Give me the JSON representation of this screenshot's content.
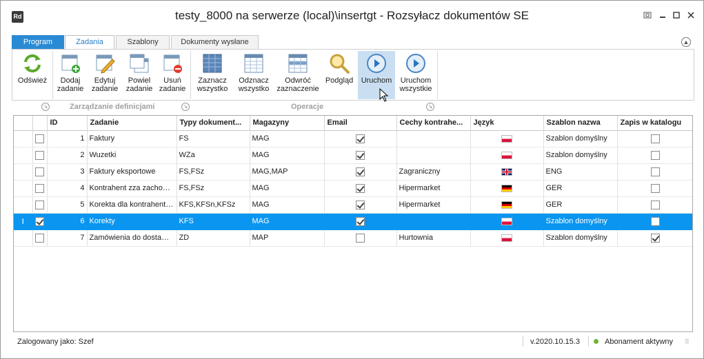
{
  "window": {
    "title": "testy_8000 na serwerze (local)\\insertgt - Rozsyłacz dokumentów SE",
    "logo_text": "Rd"
  },
  "tabs": [
    {
      "label": "Program"
    },
    {
      "label": "Zadania"
    },
    {
      "label": "Szablony"
    },
    {
      "label": "Dokumenty wysłane"
    }
  ],
  "ribbon": {
    "refresh": "Odśwież",
    "add": "Dodaj\nzadanie",
    "edit": "Edytuj\nzadanie",
    "duplicate": "Powiel\nzadanie",
    "delete": "Usuń\nzadanie",
    "select_all": "Zaznacz\nwszystko",
    "deselect_all": "Odznacz\nwszystko",
    "invert": "Odwróć\nzaznaczenie",
    "preview": "Podgląd",
    "run": "Uruchom",
    "run_all": "Uruchom\nwszystkie",
    "group_definitions": "Zarządzanie definicjami",
    "group_operations": "Operacje"
  },
  "grid": {
    "columns": [
      "ID",
      "Zadanie",
      "Typy dokument...",
      "Magazyny",
      "Email",
      "Cechy kontrahe...",
      "Język",
      "Szablon nazwa",
      "Zapis w katalogu"
    ],
    "rows": [
      {
        "checked": false,
        "id": "1",
        "task": "Faktury",
        "types": "FS",
        "warehouses": "MAG",
        "email": true,
        "features": "",
        "lang": "pl",
        "template": "Szablon domyślny",
        "save": false,
        "selected": false
      },
      {
        "checked": false,
        "id": "2",
        "task": "Wuzetki",
        "types": "WZa",
        "warehouses": "MAG",
        "email": true,
        "features": "",
        "lang": "pl",
        "template": "Szablon domyślny",
        "save": false,
        "selected": false
      },
      {
        "checked": false,
        "id": "3",
        "task": "Faktury eksportowe",
        "types": "FS,FSz",
        "warehouses": "MAG,MAP",
        "email": true,
        "features": "Zagraniczny",
        "lang": "gb",
        "template": "ENG",
        "save": false,
        "selected": false
      },
      {
        "checked": false,
        "id": "4",
        "task": "Kontrahent zza zachodniej granicy",
        "types": "FS,FSz",
        "warehouses": "MAG",
        "email": true,
        "features": "Hipermarket",
        "lang": "de",
        "template": "GER",
        "save": false,
        "selected": false
      },
      {
        "checked": false,
        "id": "5",
        "task": "Korekta dla kontrahenta niemieckiego",
        "types": "KFS,KFSn,KFSz",
        "warehouses": "MAG",
        "email": true,
        "features": "Hipermarket",
        "lang": "de",
        "template": "GER",
        "save": false,
        "selected": false
      },
      {
        "checked": true,
        "id": "6",
        "task": "Korekty",
        "types": "KFS",
        "warehouses": "MAG",
        "email": true,
        "features": "",
        "lang": "pl",
        "template": "Szablon domyślny",
        "save": false,
        "selected": true
      },
      {
        "checked": false,
        "id": "7",
        "task": "Zamówienia do dostawców",
        "types": "ZD",
        "warehouses": "MAP",
        "email": false,
        "features": "Hurtownia",
        "lang": "pl",
        "template": "Szablon domyślny",
        "save": true,
        "selected": false
      }
    ]
  },
  "status": {
    "user": "Zalogowany jako: Szef",
    "version": "v.2020.10.15.3",
    "subscription": "Abonament aktywny"
  }
}
